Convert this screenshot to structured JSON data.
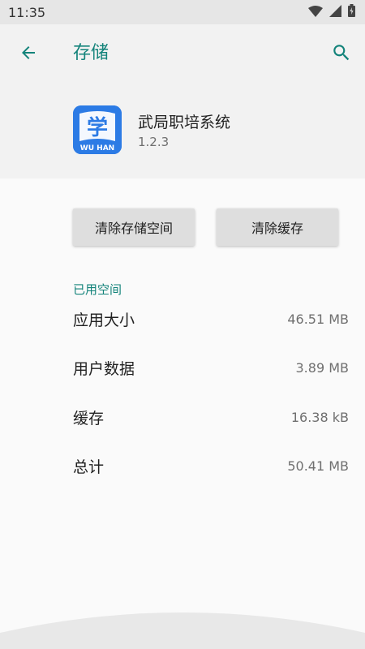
{
  "status_bar": {
    "time": "11:35",
    "icons": [
      "wifi-icon",
      "signal-icon",
      "battery-icon"
    ]
  },
  "app_bar": {
    "title": "存储",
    "back_icon": "arrow-back-icon",
    "search_icon": "search-icon"
  },
  "app": {
    "name": "武局职培系统",
    "version": "1.2.3",
    "icon": {
      "glyph": "学",
      "caption": "WU HAN",
      "color": "#2c7be5"
    }
  },
  "buttons": {
    "clear_storage": "清除存储空间",
    "clear_cache": "清除缓存"
  },
  "storage": {
    "section_title": "已用空间",
    "rows": [
      {
        "label": "应用大小",
        "value": "46.51 MB"
      },
      {
        "label": "用户数据",
        "value": "3.89 MB"
      },
      {
        "label": "缓存",
        "value": "16.38 kB"
      },
      {
        "label": "总计",
        "value": "50.41 MB"
      }
    ]
  },
  "colors": {
    "accent": "#13837a",
    "background": "#fafafa",
    "header": "#f2f2f2",
    "status_bar": "#e6e6e6"
  }
}
